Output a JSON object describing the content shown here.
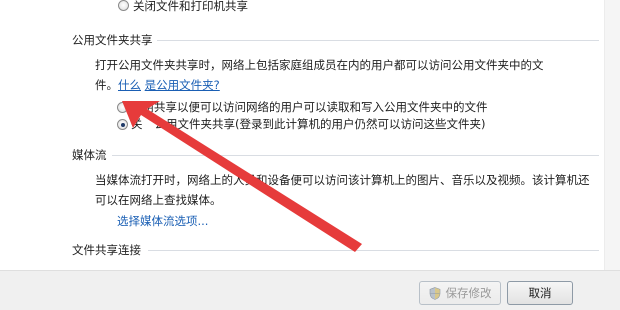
{
  "file_printer_sharing": {
    "option_off_label": "关闭文件和打印机共享"
  },
  "public_folder_sharing": {
    "title": "公用文件夹共享",
    "description": "打开公用文件夹共享时，网络上包括家庭组成员在内的用户都可以访问公用文件夹中的文件。",
    "help_link": "什么是公用文件夹?",
    "help_link_part1": "什么",
    "help_link_part2": "是公用文件夹?",
    "option_on_label": "启用共享以便可以访问网络的用户可以读取和写入公用文件夹中的文件",
    "option_off_label": "关闭公用文件夹共享(登录到此计算机的用户仍然可以访问这些文件夹)",
    "option_off_prefix": "关",
    "option_off_rest": "公用文件夹共享(登录到此计算机的用户仍然可以访问这些文件夹)",
    "selected": "off"
  },
  "media_streaming": {
    "title": "媒体流",
    "description_line1": "当媒体流打开时，网络上的人员和设备便可以访问该计算机上的图片、音乐以及视频。该计算机还",
    "description_line2": "可以在网络上查找媒体。",
    "options_link": "选择媒体流选项..."
  },
  "file_sharing_connections": {
    "title": "文件共享连接"
  },
  "buttons": {
    "save": "保存修改",
    "cancel": "取消"
  },
  "colors": {
    "annotation_arrow": "#e63b3b",
    "link": "#1a5fb4"
  },
  "icons": {
    "save_button_icon": "uac-shield-icon"
  }
}
